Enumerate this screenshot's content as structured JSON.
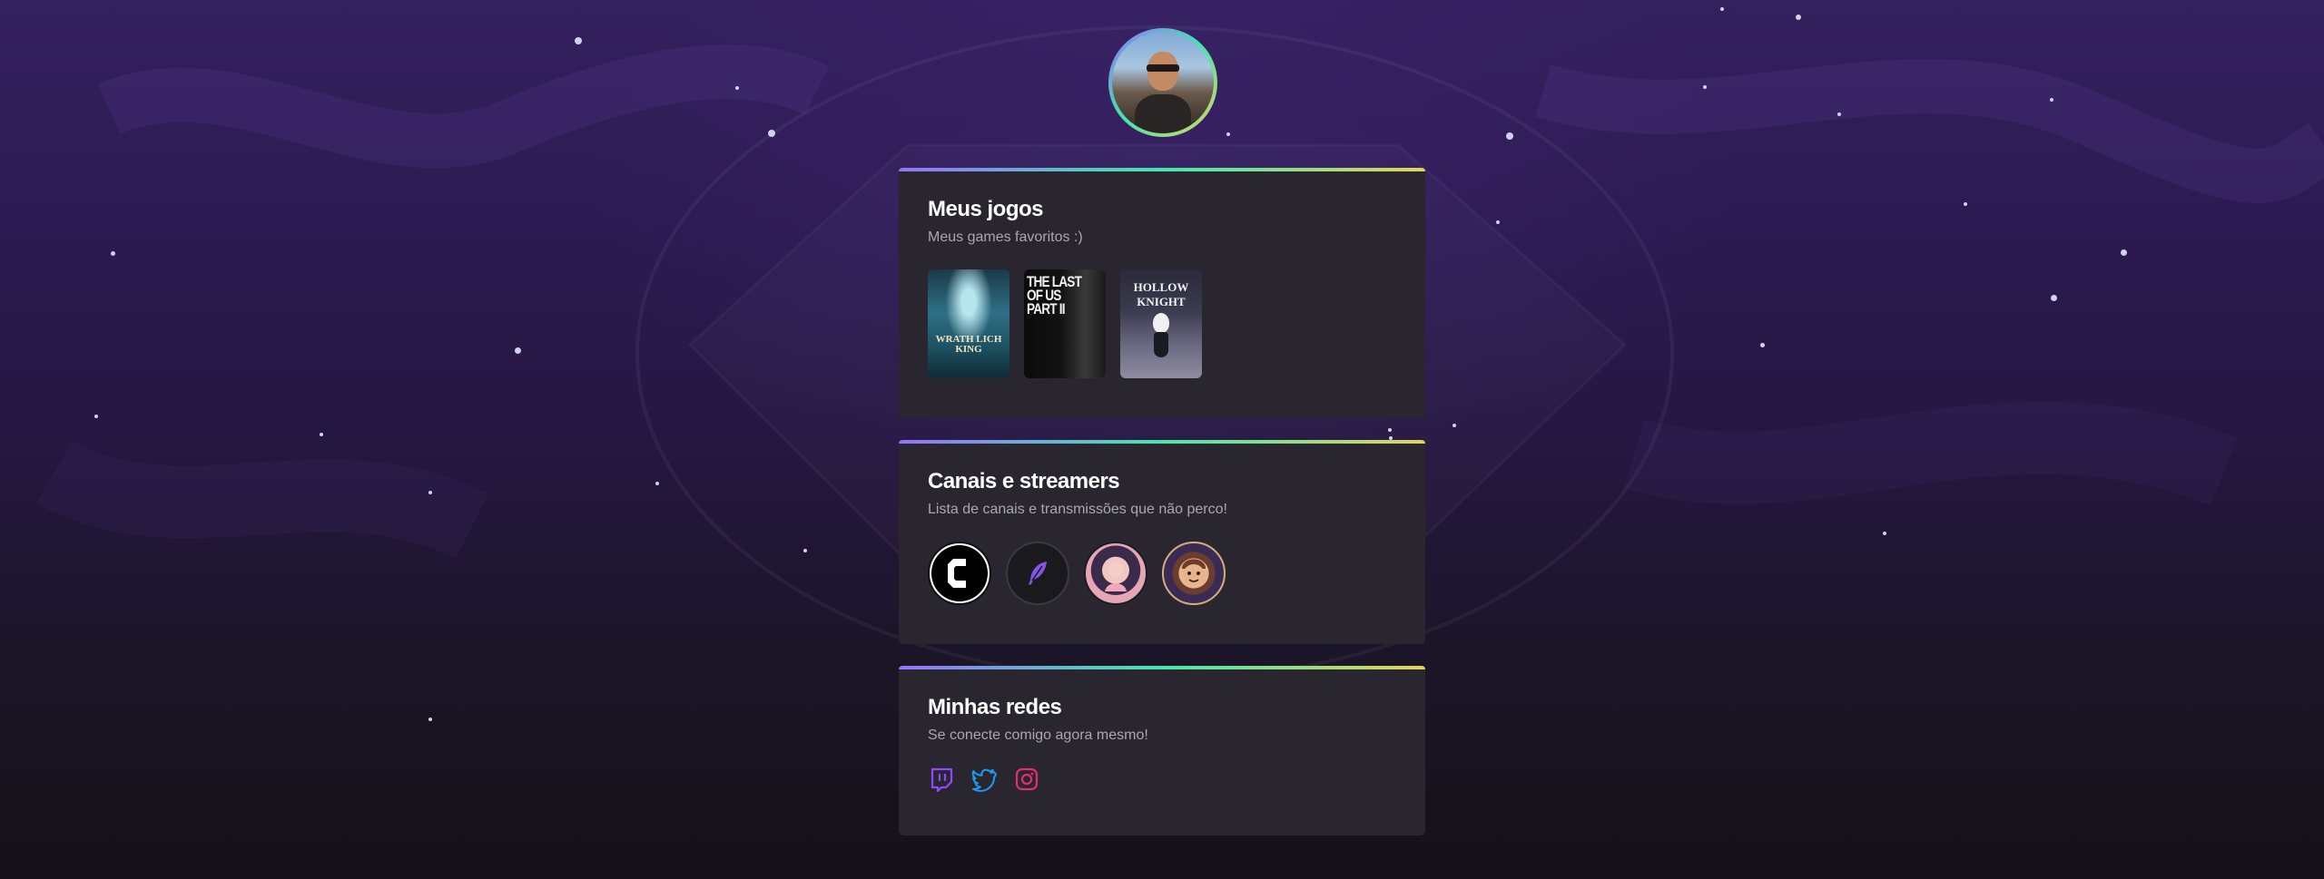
{
  "colors": {
    "accent_gradient": [
      "#9572fc",
      "#43e7ad",
      "#e2d45c"
    ],
    "card_bg": "#29262f",
    "subtitle": "#a8a8b3",
    "twitch": "#9147ff",
    "twitter": "#1d9bf0",
    "instagram": "#e1306c"
  },
  "profile": {
    "avatar_alt": "Profile photo"
  },
  "games_section": {
    "title": "Meus jogos",
    "subtitle": "Meus games favoritos :)",
    "games": [
      {
        "name": "WoW Wrath of the Lich King Classic",
        "cover_text": "WRATH LICH KING"
      },
      {
        "name": "The Last of Us Part II",
        "cover_text": "THE LAST OF US PART II"
      },
      {
        "name": "Hollow Knight",
        "cover_text": "HOLLOW KNIGHT"
      }
    ]
  },
  "channels_section": {
    "title": "Canais e streamers",
    "subtitle": "Lista de canais e transmissões que não perco!",
    "channels": [
      {
        "icon": "rocketseat-logo-icon"
      },
      {
        "icon": "feather-logo-icon"
      },
      {
        "icon": "streamer-avatar"
      },
      {
        "icon": "cartoon-avatar"
      }
    ]
  },
  "social_section": {
    "title": "Minhas redes",
    "subtitle": "Se conecte comigo agora mesmo!",
    "links": [
      {
        "icon": "twitch-icon"
      },
      {
        "icon": "twitter-icon"
      },
      {
        "icon": "instagram-icon"
      }
    ]
  }
}
